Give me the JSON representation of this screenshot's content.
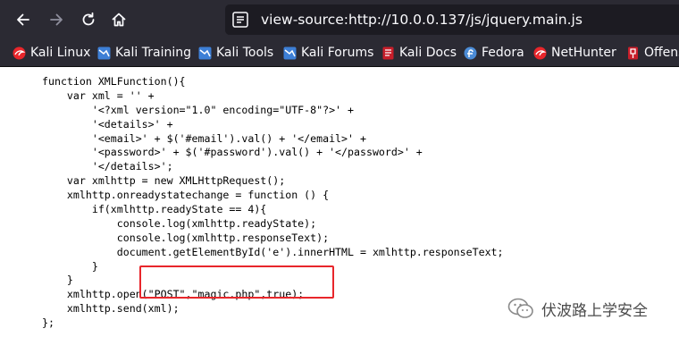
{
  "browser": {
    "url": "view-source:http://10.0.0.137/js/jquery.main.js",
    "bookmarks": [
      {
        "label": "Kali Linux",
        "icon": "kali-dragon-icon"
      },
      {
        "label": "Kali Training",
        "icon": "kali-training-icon"
      },
      {
        "label": "Kali Tools",
        "icon": "kali-tools-icon"
      },
      {
        "label": "Kali Forums",
        "icon": "kali-forums-icon"
      },
      {
        "label": "Kali Docs",
        "icon": "kali-docs-icon"
      },
      {
        "label": "Fedora",
        "icon": "fedora-icon"
      },
      {
        "label": "NetHunter",
        "icon": "nethunter-icon"
      },
      {
        "label": "Offens",
        "icon": "offsec-icon"
      }
    ]
  },
  "source": {
    "lines": [
      "function XMLFunction(){",
      "    var xml = '' +",
      "        '<?xml version=\"1.0\" encoding=\"UTF-8\"?>' +",
      "        '<details>' +",
      "        '<email>' + $('#email').val() + '</email>' +",
      "        '<password>' + $('#password').val() + '</password>' +",
      "        '</details>';",
      "    var xmlhttp = new XMLHttpRequest();",
      "    xmlhttp.onreadystatechange = function () {",
      "        if(xmlhttp.readyState == 4){",
      "            console.log(xmlhttp.readyState);",
      "            console.log(xmlhttp.responseText);",
      "            document.getElementById('e').innerHTML = xmlhttp.responseText;",
      "        }",
      "    }",
      "    xmlhttp.open(\"POST\",\"magic.php\",true);",
      "    xmlhttp.send(xml);",
      "};"
    ]
  },
  "watermark": {
    "text": "伏波路上学安全"
  },
  "colors": {
    "toolbar": "#2b2a33",
    "urlbar": "#1c1b22",
    "highlight": "#e8262b"
  }
}
